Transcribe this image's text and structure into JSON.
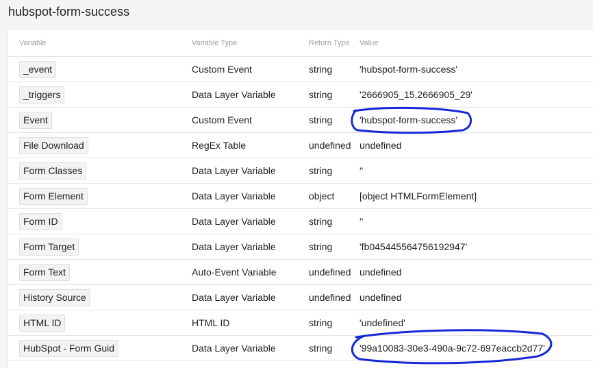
{
  "page_title": "hubspot-form-success",
  "columns": {
    "variable": "Variable",
    "variable_type": "Variable Type",
    "return_type": "Return Type",
    "value": "Value"
  },
  "rows": [
    {
      "variable": "_event",
      "type": "Custom Event",
      "return_type": "string",
      "value": "'hubspot-form-success'"
    },
    {
      "variable": "_triggers",
      "type": "Data Layer Variable",
      "return_type": "string",
      "value": "'2666905_15,2666905_29'"
    },
    {
      "variable": "Event",
      "type": "Custom Event",
      "return_type": "string",
      "value": "'hubspot-form-success'"
    },
    {
      "variable": "File Download",
      "type": "RegEx Table",
      "return_type": "undefined",
      "value": "undefined"
    },
    {
      "variable": "Form Classes",
      "type": "Data Layer Variable",
      "return_type": "string",
      "value": "''"
    },
    {
      "variable": "Form Element",
      "type": "Data Layer Variable",
      "return_type": "object",
      "value": "[object HTMLFormElement]"
    },
    {
      "variable": "Form ID",
      "type": "Data Layer Variable",
      "return_type": "string",
      "value": "''"
    },
    {
      "variable": "Form Target",
      "type": "Data Layer Variable",
      "return_type": "string",
      "value": "'fb045445564756192947'"
    },
    {
      "variable": "Form Text",
      "type": "Auto-Event Variable",
      "return_type": "undefined",
      "value": "undefined"
    },
    {
      "variable": "History Source",
      "type": "Data Layer Variable",
      "return_type": "undefined",
      "value": "undefined"
    },
    {
      "variable": "HTML ID",
      "type": "HTML ID",
      "return_type": "string",
      "value": "'undefined'"
    },
    {
      "variable": "HubSpot - Form Guid",
      "type": "Data Layer Variable",
      "return_type": "string",
      "value": "'99a10083-30e3-490a-9c72-697eaccb2d77'"
    }
  ],
  "annotation_color": "#1428d8"
}
